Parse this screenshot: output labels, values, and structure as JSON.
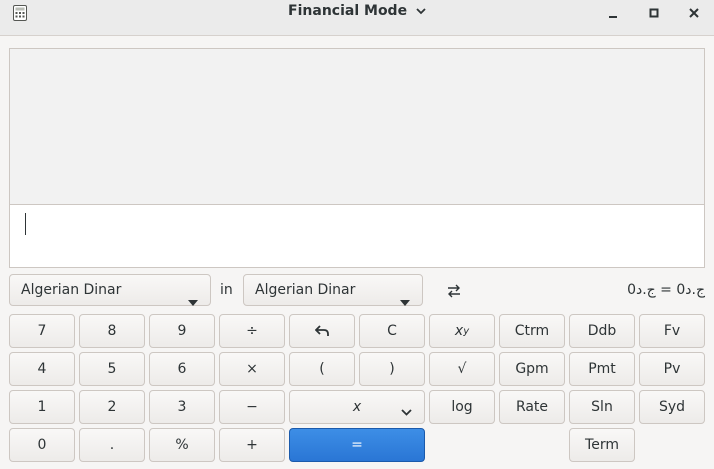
{
  "window": {
    "title": "Financial Mode"
  },
  "display": {
    "history": "",
    "input": ""
  },
  "currency": {
    "from": "Algerian Dinar",
    "in_label": "in",
    "to": "Algerian Dinar",
    "result": "ج.د0 = ج.د0"
  },
  "keys": {
    "k7": "7",
    "k8": "8",
    "k9": "9",
    "divide": "÷",
    "clear": "C",
    "ctrm": "Ctrm",
    "ddb": "Ddb",
    "fv": "Fv",
    "k4": "4",
    "k5": "5",
    "k6": "6",
    "multiply": "×",
    "lparen": "(",
    "rparen": ")",
    "sqrt": "√",
    "gpm": "Gpm",
    "pmt": "Pmt",
    "pv": "Pv",
    "k1": "1",
    "k2": "2",
    "k3": "3",
    "minus": "−",
    "x": "x",
    "log": "log",
    "rate": "Rate",
    "sln": "Sln",
    "syd": "Syd",
    "k0": "0",
    "dot": ".",
    "percent": "%",
    "plus": "+",
    "equals": "=",
    "term": "Term",
    "power_base": "x",
    "power_exp": "y"
  },
  "icons": {
    "app": "calculator-icon",
    "title_dropdown": "chevron-down-icon",
    "minimize": "minimize-icon",
    "maximize": "maximize-icon",
    "close": "close-icon",
    "undo": "undo-icon",
    "swap": "swap-icon"
  }
}
